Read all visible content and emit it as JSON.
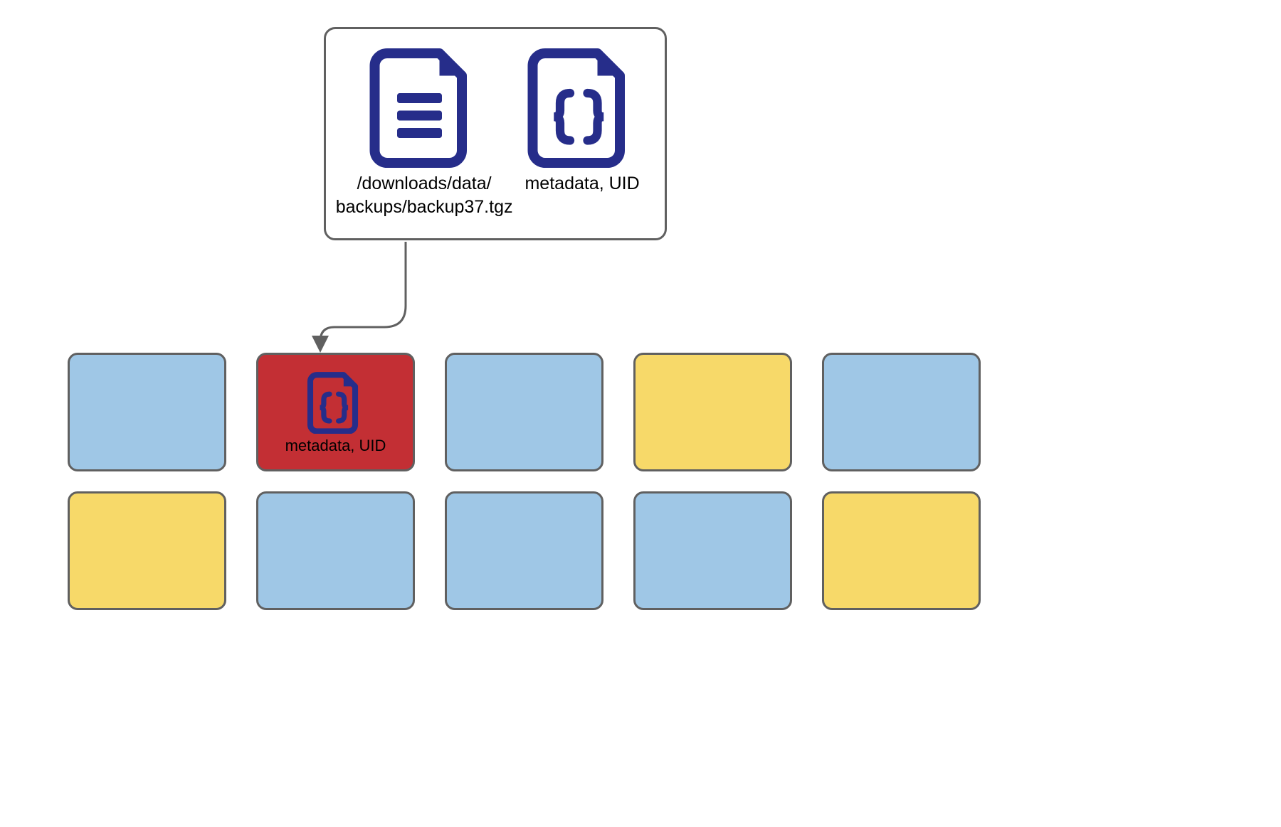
{
  "callout": {
    "file_path_line1": "/downloads/data/",
    "file_path_line2": "backups/backup37.tgz",
    "metadata_label": "metadata, UID"
  },
  "target_node": {
    "label": "metadata, UID"
  },
  "colors": {
    "blue": "#9fc7e6",
    "yellow": "#f7d969",
    "red": "#c32f34",
    "icon_navy": "#262d8a",
    "border_gray": "#606060"
  },
  "grid": {
    "rows": [
      [
        "blue",
        "red",
        "blue",
        "yellow",
        "blue"
      ],
      [
        "yellow",
        "blue",
        "blue",
        "blue",
        "yellow"
      ]
    ]
  }
}
